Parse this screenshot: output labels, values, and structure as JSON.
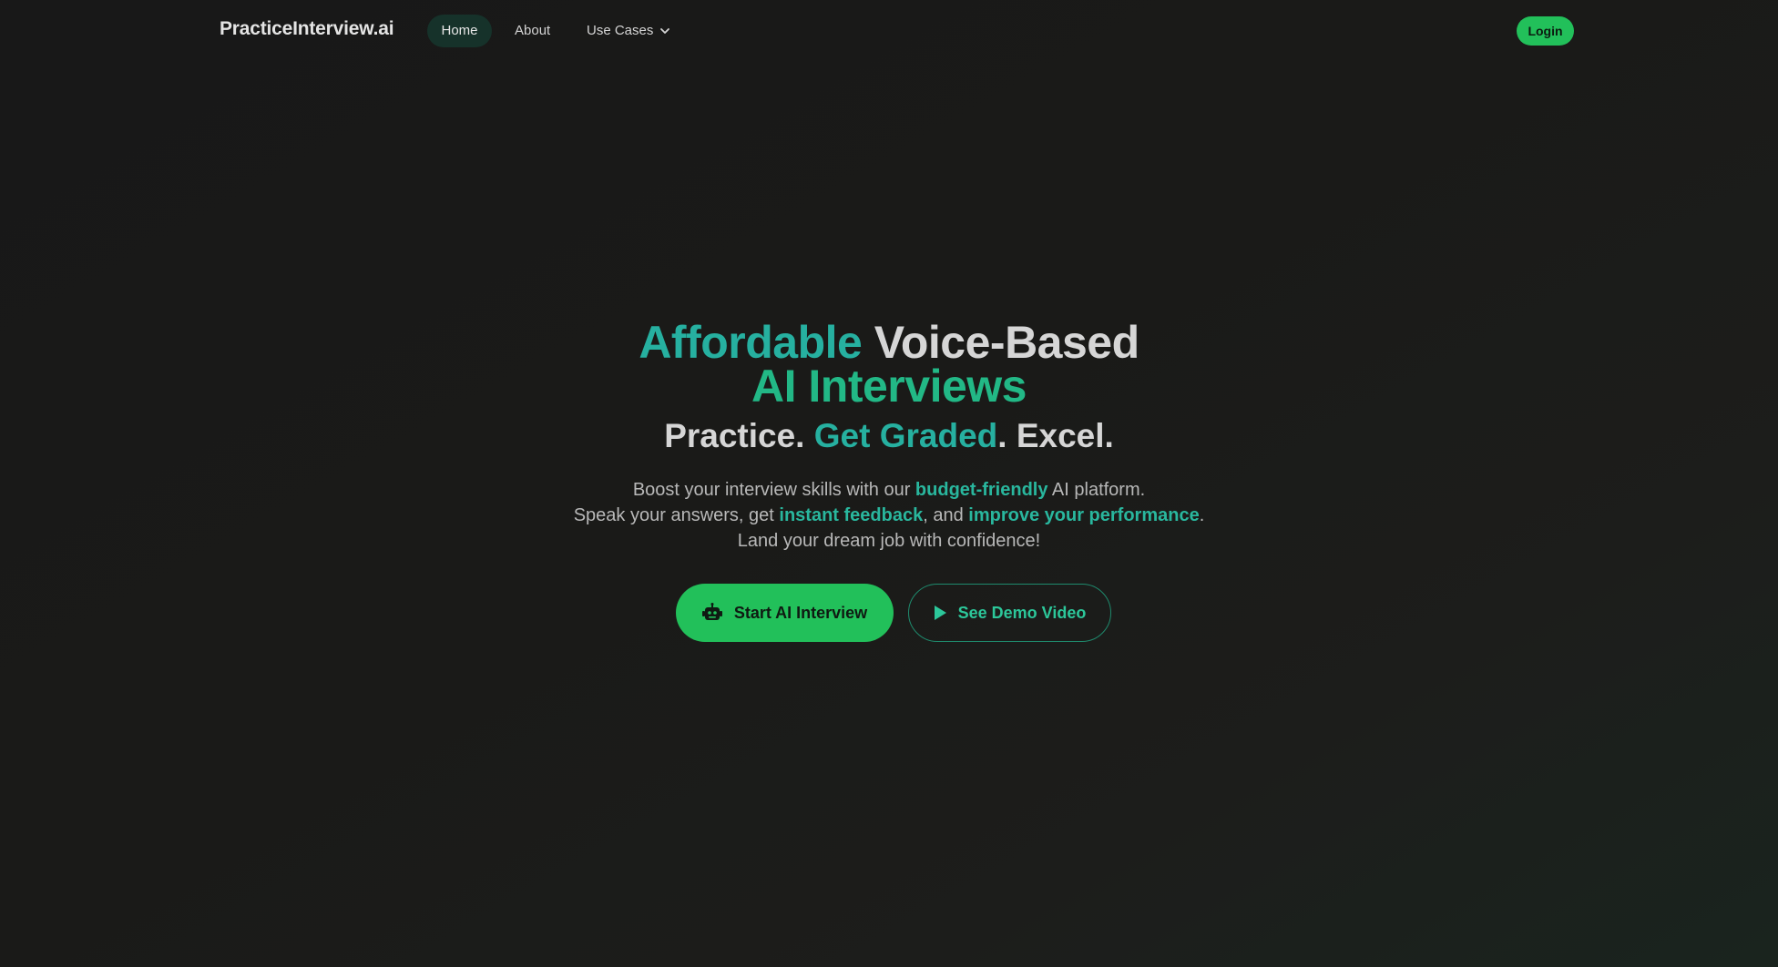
{
  "nav": {
    "brand": "PracticeInterview.ai",
    "links": [
      {
        "label": "Home",
        "active": true
      },
      {
        "label": "About",
        "active": false
      },
      {
        "label": "Use Cases",
        "active": false
      }
    ],
    "login_label": "Login"
  },
  "hero": {
    "title": {
      "part1": "Affordable",
      "part2": "Voice-Based",
      "line2": "AI Interviews"
    },
    "subtitle": {
      "word1": "Practice.",
      "word2": "Get Graded",
      "word2_suffix": ".",
      "word3": "Excel."
    },
    "description": {
      "line1_pre": "Boost your interview skills with our ",
      "line1_highlight": "budget-friendly",
      "line1_post": " AI platform.",
      "line2_pre": "Speak your answers, get ",
      "line2_highlight1": "instant feedback",
      "line2_mid": ", and ",
      "line2_highlight2": "improve your performance",
      "line2_post": ".",
      "line3": "Land your dream job with confidence!"
    },
    "cta": {
      "primary_label": "Start AI Interview",
      "primary_icon": "robot-icon",
      "secondary_label": "See Demo Video",
      "secondary_icon": "play-icon"
    }
  },
  "colors": {
    "accent_green": "#22c05a",
    "accent_teal": "#26b0a0",
    "background": "#1a1a18"
  }
}
